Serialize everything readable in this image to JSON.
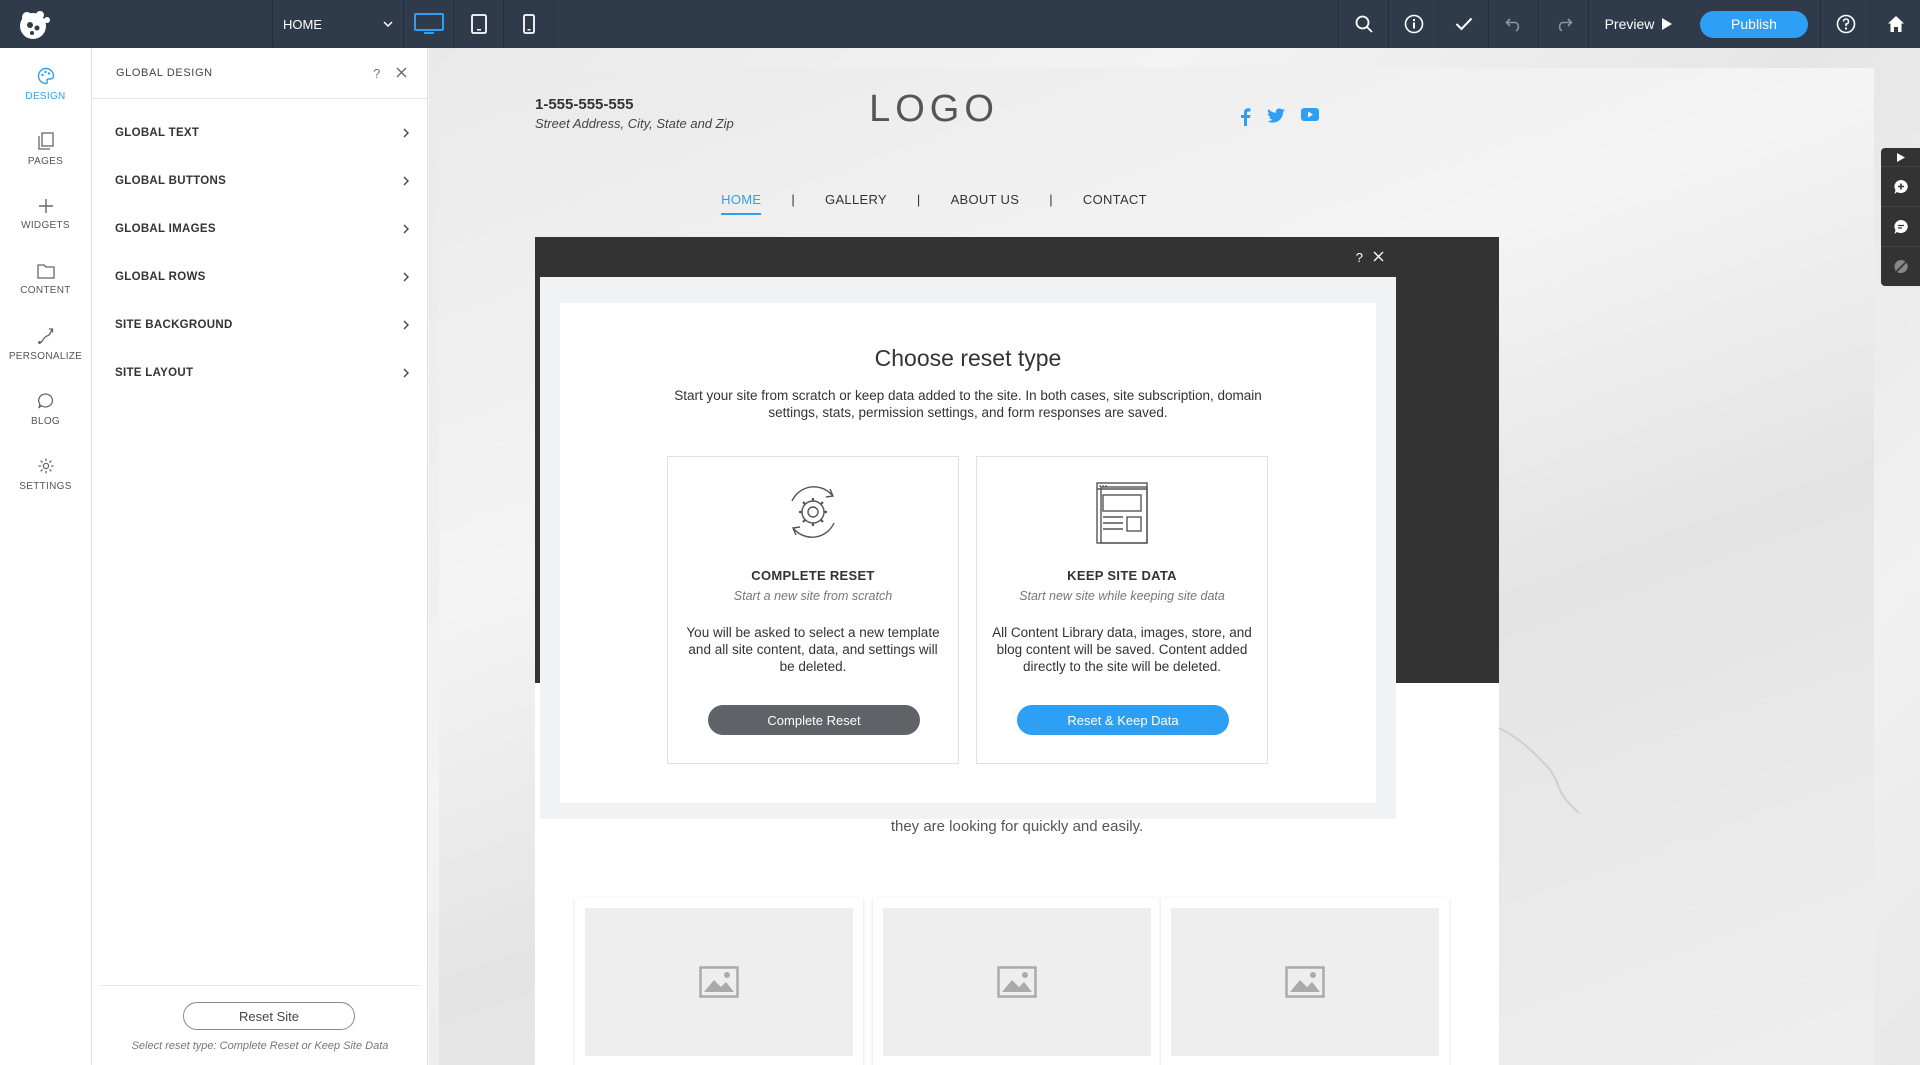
{
  "topbar": {
    "page_selector": "HOME",
    "preview_label": "Preview",
    "publish_label": "Publish"
  },
  "rail": {
    "items": [
      {
        "label": "DESIGN"
      },
      {
        "label": "PAGES"
      },
      {
        "label": "WIDGETS"
      },
      {
        "label": "CONTENT"
      },
      {
        "label": "PERSONALIZE"
      },
      {
        "label": "BLOG"
      },
      {
        "label": "SETTINGS"
      }
    ]
  },
  "panel": {
    "title": "GLOBAL DESIGN",
    "help": "?",
    "items": [
      {
        "label": "GLOBAL TEXT"
      },
      {
        "label": "GLOBAL BUTTONS"
      },
      {
        "label": "GLOBAL IMAGES"
      },
      {
        "label": "GLOBAL ROWS"
      },
      {
        "label": "SITE BACKGROUND"
      },
      {
        "label": "SITE LAYOUT"
      }
    ],
    "reset_label": "Reset Site",
    "footer_note": "Select reset type: Complete Reset or Keep Site Data"
  },
  "site": {
    "phone": "1-555-555-555",
    "address": "Street Address, City, State and Zip",
    "logo": "LOGO",
    "nav": {
      "home": "HOME",
      "gallery": "GALLERY",
      "about": "ABOUT US",
      "contact": "CONTACT",
      "separator": "|"
    },
    "tagline": "they are looking for quickly and easily."
  },
  "modal": {
    "help": "?",
    "title": "Choose reset type",
    "description": "Start your site from scratch or keep data added to the site. In both cases, site subscription, domain settings, stats, permission settings, and form responses are saved.",
    "complete": {
      "name": "COMPLETE RESET",
      "subtitle": "Start a new site from scratch",
      "text": "You will be asked to select a new template and all site content, data, and settings will be deleted.",
      "button": "Complete Reset"
    },
    "keep": {
      "name": "KEEP SITE DATA",
      "subtitle": "Start new site while keeping site data",
      "text": "All Content Library data, images, store, and blog content will be saved. Content added directly to the site will be deleted.",
      "button": "Reset & Keep Data"
    }
  },
  "colors": {
    "accent": "#2d9ff5",
    "topbar": "#2f3b4b",
    "complete_button": "#5f6368"
  }
}
